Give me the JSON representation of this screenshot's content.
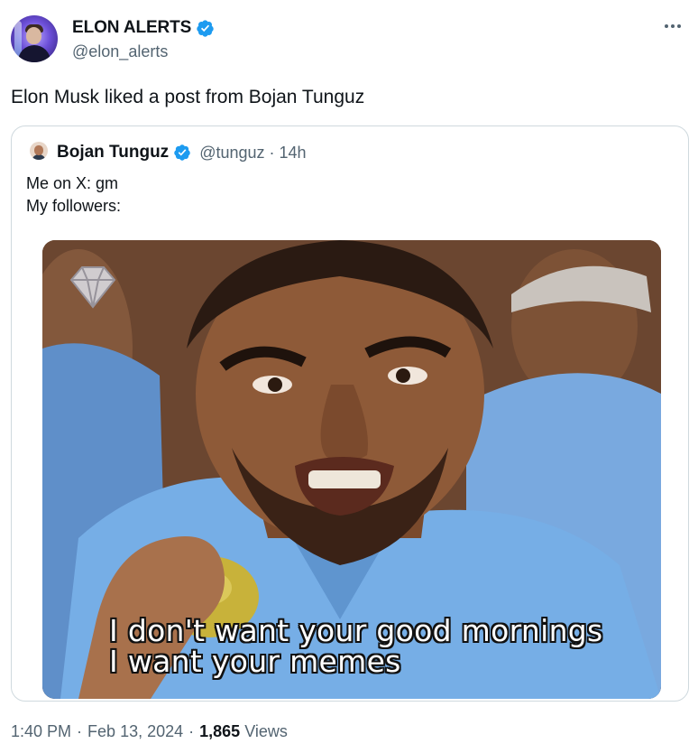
{
  "author": {
    "display_name": "ELON ALERTS",
    "handle": "@elon_alerts",
    "verified": true
  },
  "tweet": {
    "text": "Elon Musk liked a post from Bojan Tunguz"
  },
  "quoted": {
    "display_name": "Bojan Tunguz",
    "handle": "@tunguz",
    "separator": "·",
    "time": "14h",
    "lines": [
      "Me on X: gm",
      "My followers:"
    ],
    "media": {
      "caption_lines": [
        "I don't want your good mornings",
        "I want your memes"
      ]
    }
  },
  "footer": {
    "time": "1:40 PM",
    "sep1": "·",
    "date": "Feb 13, 2024",
    "sep2": "·",
    "views_count": "1,865",
    "views_label": "Views"
  },
  "colors": {
    "verified_blue": "#1d9bf0",
    "secondary_text": "#536471",
    "primary_text": "#0f1419",
    "border": "#cfd9de"
  }
}
